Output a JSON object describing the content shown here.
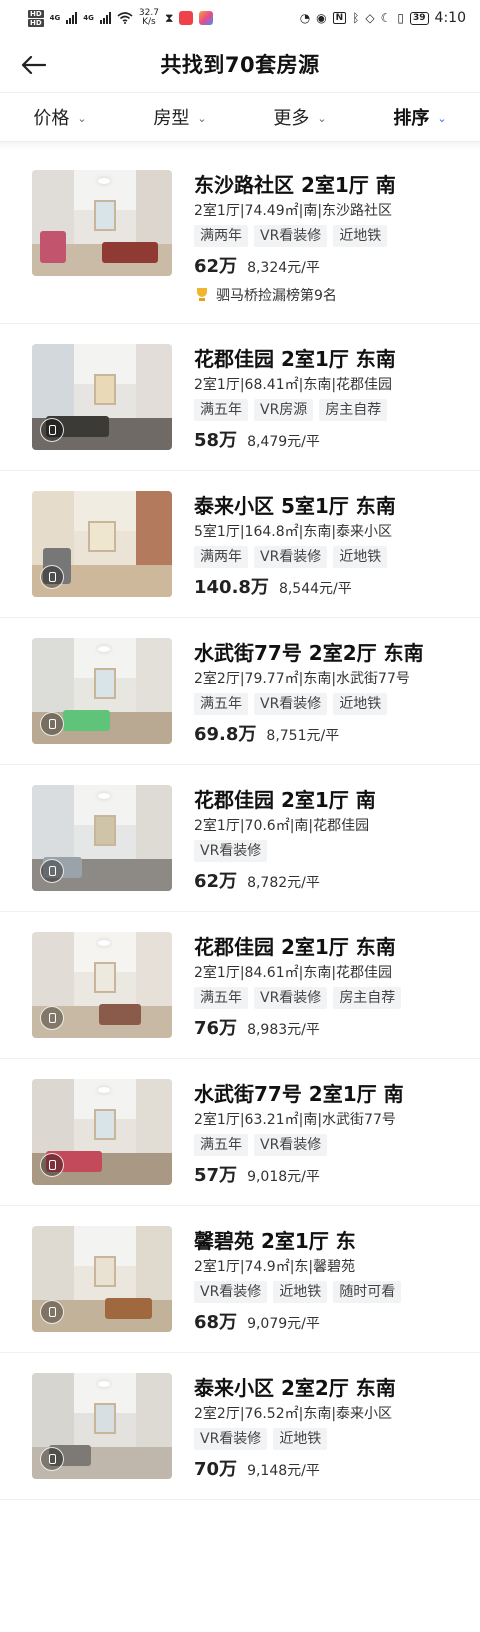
{
  "status_bar": {
    "hd1": "HD",
    "hd2": "HD",
    "net_type_1": "4G",
    "net_type_2": "4G",
    "net_speed_value": "32.7",
    "net_speed_unit": "K/s",
    "nfc": "N",
    "battery": "39",
    "time": "4:10"
  },
  "header": {
    "title": "共找到70套房源"
  },
  "filters": [
    {
      "label": "价格"
    },
    {
      "label": "房型"
    },
    {
      "label": "更多"
    },
    {
      "label": "排序"
    }
  ],
  "listings": [
    {
      "title": "东沙路社区 2室1厅 南",
      "meta": "2室1厅|74.49㎡|南|东沙路社区",
      "tags": [
        "满两年",
        "VR看装修",
        "近地铁"
      ],
      "price": "62万",
      "unit_price": "8,324元/平",
      "rank": "驷马桥捡漏榜第9名"
    },
    {
      "title": "花郡佳园 2室1厅 东南",
      "meta": "2室1厅|68.41㎡|东南|花郡佳园",
      "tags": [
        "满五年",
        "VR房源",
        "房主自荐"
      ],
      "price": "58万",
      "unit_price": "8,479元/平"
    },
    {
      "title": "泰来小区 5室1厅 东南",
      "meta": "5室1厅|164.8㎡|东南|泰来小区",
      "tags": [
        "满两年",
        "VR看装修",
        "近地铁"
      ],
      "price": "140.8万",
      "unit_price": "8,544元/平"
    },
    {
      "title": "水武街77号 2室2厅 东南",
      "meta": "2室2厅|79.77㎡|东南|水武街77号",
      "tags": [
        "满五年",
        "VR看装修",
        "近地铁"
      ],
      "price": "69.8万",
      "unit_price": "8,751元/平"
    },
    {
      "title": "花郡佳园 2室1厅 南",
      "meta": "2室1厅|70.6㎡|南|花郡佳园",
      "tags": [
        "VR看装修"
      ],
      "price": "62万",
      "unit_price": "8,782元/平"
    },
    {
      "title": "花郡佳园 2室1厅 东南",
      "meta": "2室1厅|84.61㎡|东南|花郡佳园",
      "tags": [
        "满五年",
        "VR看装修",
        "房主自荐"
      ],
      "price": "76万",
      "unit_price": "8,983元/平"
    },
    {
      "title": "水武街77号 2室1厅 南",
      "meta": "2室1厅|63.21㎡|南|水武街77号",
      "tags": [
        "满五年",
        "VR看装修"
      ],
      "price": "57万",
      "unit_price": "9,018元/平"
    },
    {
      "title": "馨碧苑 2室1厅 东",
      "meta": "2室1厅|74.9㎡|东|馨碧苑",
      "tags": [
        "VR看装修",
        "近地铁",
        "随时可看"
      ],
      "price": "68万",
      "unit_price": "9,079元/平"
    },
    {
      "title": "泰来小区 2室2厅 东南",
      "meta": "2室2厅|76.52㎡|东南|泰来小区",
      "tags": [
        "VR看装修",
        "近地铁"
      ],
      "price": "70万",
      "unit_price": "9,148元/平"
    }
  ],
  "colors": {
    "sort_accent": "#3072f6",
    "trophy": "#f0b52c",
    "tag_bg": "#f2f3f5"
  }
}
